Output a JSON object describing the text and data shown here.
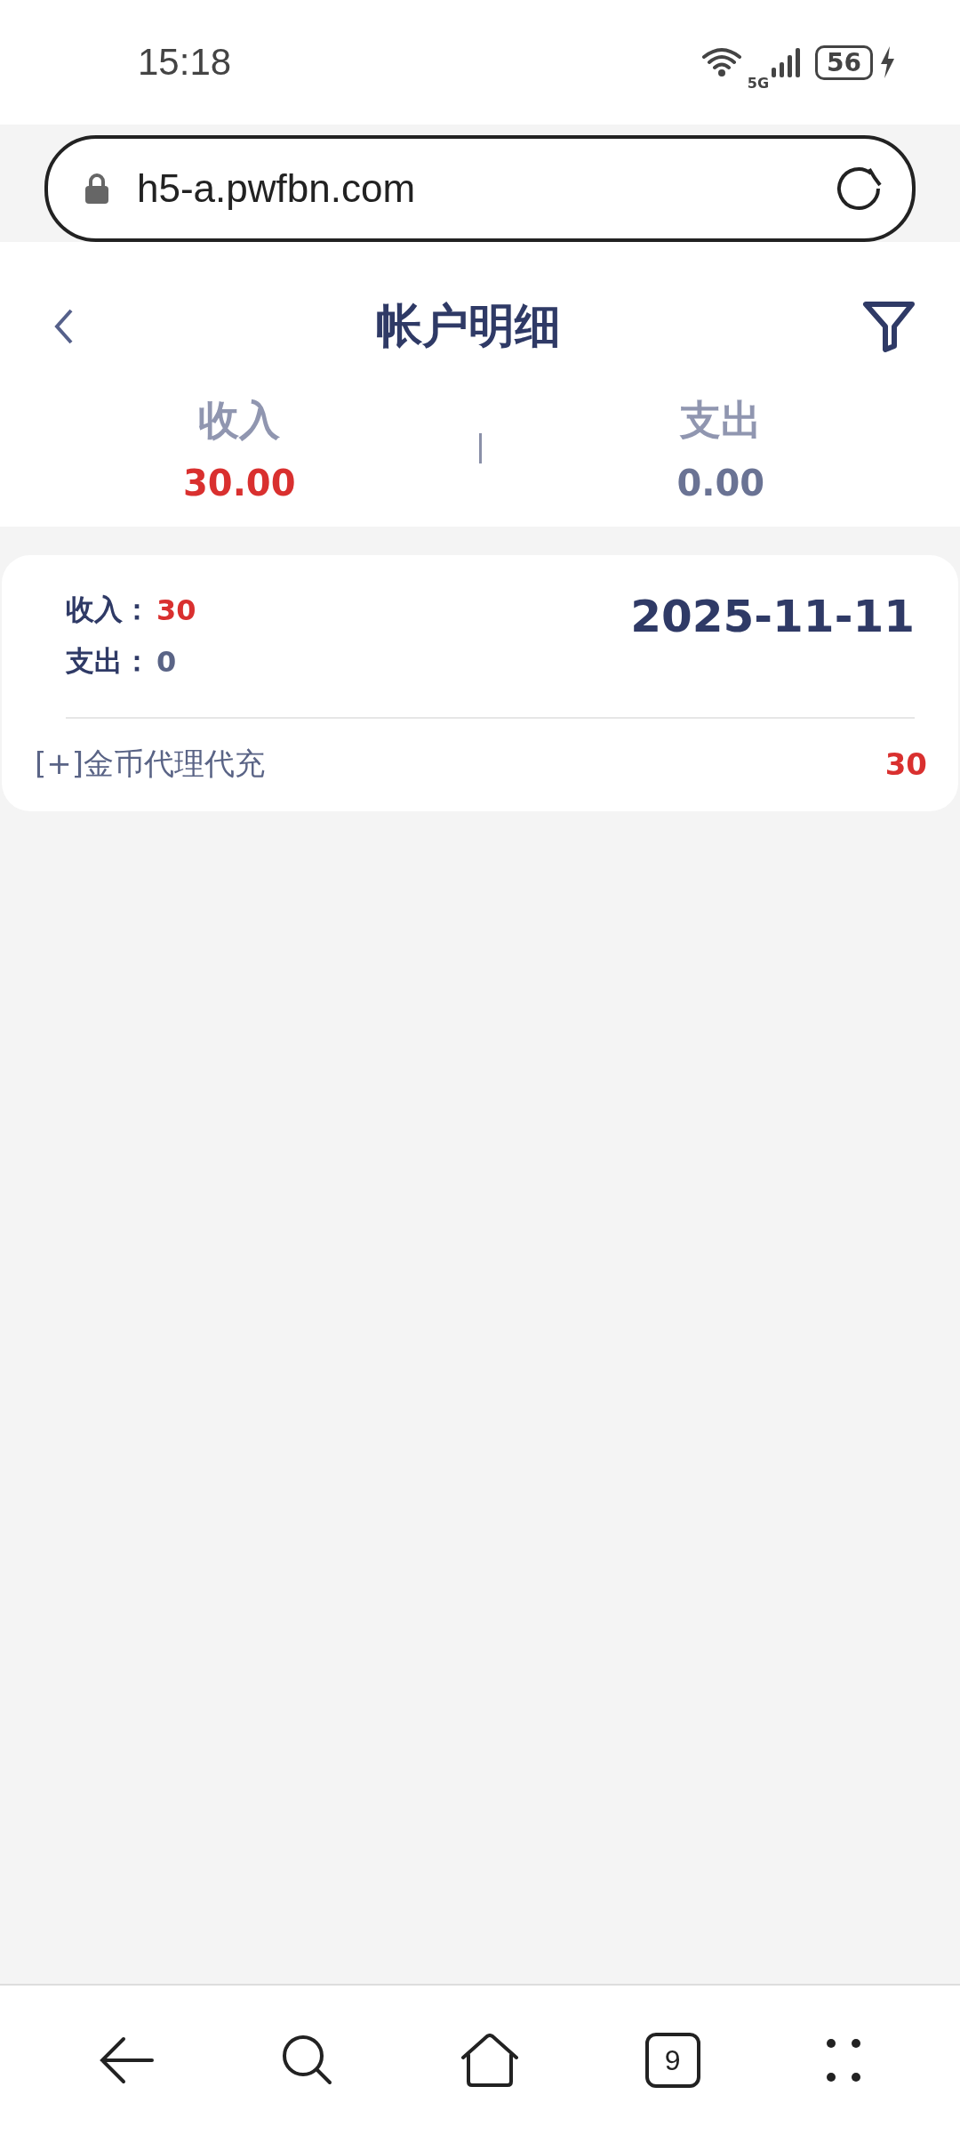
{
  "status_bar": {
    "time": "15:18",
    "network": "5G",
    "battery": "56"
  },
  "address_bar": {
    "url": "h5-a.pwfbn.com"
  },
  "header": {
    "title": "帐户明细"
  },
  "summary": [
    {
      "label": "收入",
      "value": "30.00",
      "kind": "income"
    },
    {
      "label": "支出",
      "value": "0.00",
      "kind": "expense"
    }
  ],
  "records": [
    {
      "date": "2025-11-11",
      "totals": [
        {
          "label": "收入：",
          "value": "30",
          "kind": "income"
        },
        {
          "label": "支出：",
          "value": "0",
          "kind": "expense"
        }
      ],
      "entries": [
        {
          "description": "[+]金币代理代充",
          "amount": "30",
          "kind": "income"
        }
      ]
    }
  ],
  "bottom_nav": {
    "tab_count": "9"
  }
}
